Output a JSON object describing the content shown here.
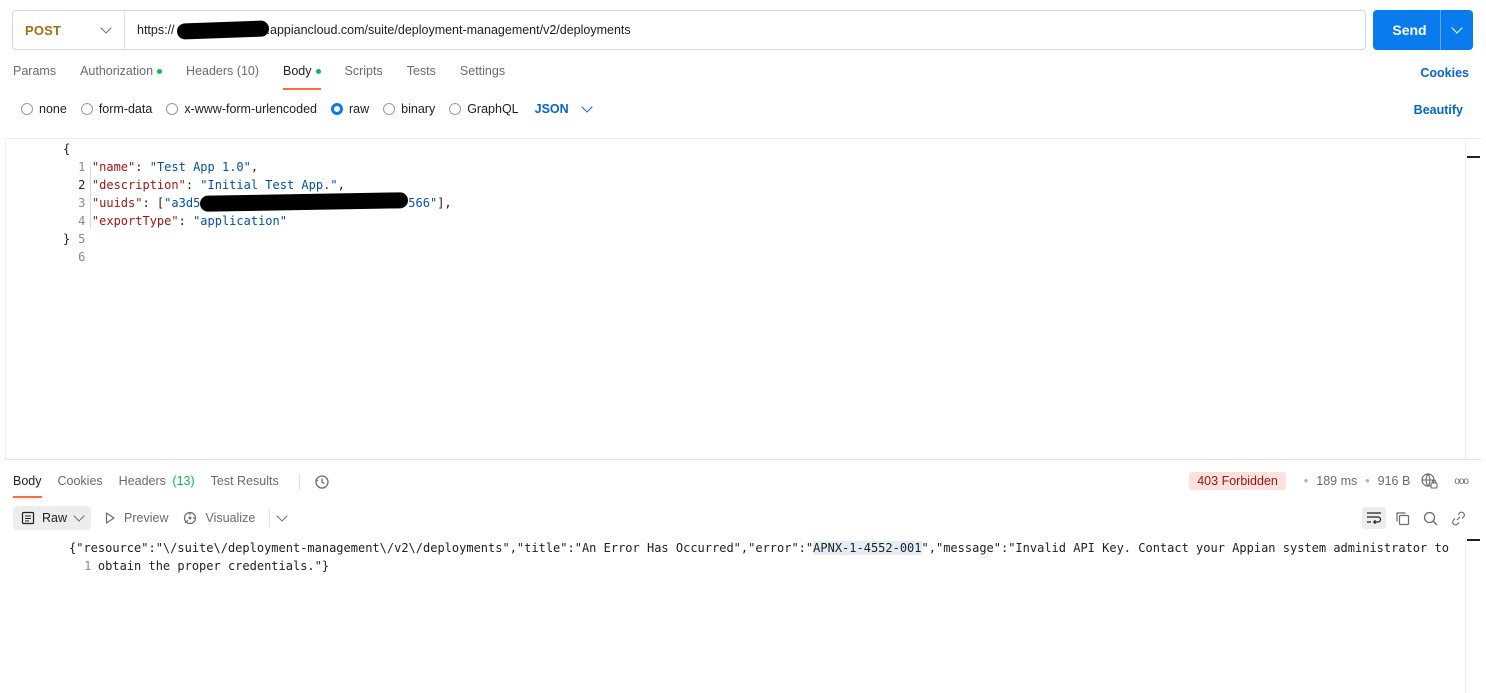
{
  "request": {
    "method": "POST",
    "url_prefix": "https://",
    "url_suffix": ".appiancloud.com/suite/deployment-management/v2/deployments",
    "send_label": "Send"
  },
  "request_tabs": [
    {
      "label": "Params"
    },
    {
      "label": "Authorization"
    },
    {
      "label": "Headers",
      "count": "(10)"
    },
    {
      "label": "Body"
    },
    {
      "label": "Scripts"
    },
    {
      "label": "Tests"
    },
    {
      "label": "Settings"
    }
  ],
  "cookies_label": "Cookies",
  "body_types": [
    "none",
    "form-data",
    "x-www-form-urlencoded",
    "raw",
    "binary",
    "GraphQL"
  ],
  "body_format": "JSON",
  "beautify_label": "Beautify",
  "editor": {
    "line_numbers": [
      "1",
      "2",
      "3",
      "4",
      "5",
      "6"
    ],
    "open_brace": "{",
    "close_brace": "}",
    "name_key": "\"name\"",
    "name_value": "\"Test App 1.0\"",
    "desc_key": "\"description\"",
    "desc_value": "\"Initial Test App.\"",
    "uuids_key": "\"uuids\"",
    "uuids_value_start": "\"a3d5",
    "uuids_value_end": "566\"",
    "export_key": "\"exportType\"",
    "export_value": "\"application\""
  },
  "response_tabs": [
    {
      "label": "Body"
    },
    {
      "label": "Cookies"
    },
    {
      "label": "Headers",
      "count": "(13)"
    },
    {
      "label": "Test Results"
    }
  ],
  "response_meta": {
    "status": "403 Forbidden",
    "time": "189 ms",
    "size": "916 B",
    "more": "ooo"
  },
  "response_toolbar": {
    "raw_label": "Raw",
    "preview_label": "Preview",
    "visualize_label": "Visualize"
  },
  "response_body": {
    "line_number": "1",
    "text_before": "{\"resource\":\"\\/suite\\/deployment-management\\/v2\\/deployments\",\"title\":\"An Error Has Occurred\",\"error\":\"",
    "error_code": "APNX-1-4552-001",
    "text_after": "\",\"message\":\"Invalid API Key. Contact your Appian system administrator to\n    obtain the proper credentials.\"}"
  },
  "colors": {
    "accent_orange": "#ff6c37",
    "send_blue": "#097bed",
    "link_blue": "#0265d2",
    "status_green": "#0cbb52",
    "error_red": "#8e1a10"
  }
}
